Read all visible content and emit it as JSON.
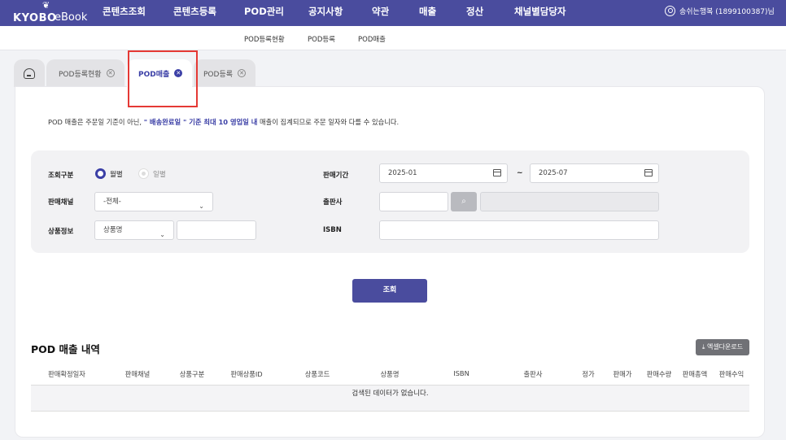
{
  "header": {
    "logo": "KYOBO eBook",
    "logo_kyobo": "KYOBO",
    "logo_ebook": "eBook",
    "logo_bird": "❦",
    "menu": [
      "콘텐츠조회",
      "콘텐츠등록",
      "POD관리",
      "공지사항",
      "약관",
      "매출",
      "정산",
      "채널별담당자"
    ],
    "user": "송쉬는행복 (1899100387)님"
  },
  "submenu": [
    "POD등록현황",
    "POD등록",
    "POD매출"
  ],
  "tabs": {
    "home_icon": "home-icon",
    "items": [
      {
        "label": "POD등록현황",
        "active": false
      },
      {
        "label": "POD매출",
        "active": true
      },
      {
        "label": "POD등록",
        "active": false
      }
    ],
    "close_glyph": "✕"
  },
  "notice": {
    "prefix": "POD 매출은 주문일 기준이 아닌, ",
    "highlight": "\" 배송완료일 \" 기준 최대 10 영업일 내",
    "suffix": " 매출이 집계되므로 주문 일자와 다를 수 있습니다."
  },
  "filter": {
    "type_label": "조회구분",
    "type_options": [
      "월별",
      "일별"
    ],
    "type_selected": "월별",
    "period_label": "판매기간",
    "period_from": "2025-01",
    "period_sep": "~",
    "period_to": "2025-07",
    "channel_label": "판매채널",
    "channel_value": "-전체-",
    "publisher_label": "출판사",
    "publisher_value": "",
    "publisher_name": "",
    "product_label": "상품정보",
    "product_type_value": "상품명",
    "product_value": "",
    "isbn_label": "ISBN",
    "isbn_value": "",
    "search_glyph": "⌕",
    "chevron": "⌄"
  },
  "search_button": "조회",
  "results": {
    "title": "POD 매출 내역",
    "excel_button": "⤓ 엑셀다운로드",
    "columns": [
      "판매확정일자",
      "판매채널",
      "상품구분",
      "판매상품ID",
      "상품코드",
      "상품명",
      "ISBN",
      "출판사",
      "정가",
      "판매가",
      "판매수량",
      "판매총액",
      "판매수익"
    ],
    "empty_message": "검색된 데이터가 없습니다."
  },
  "colors": {
    "brand": "#4a4c9e",
    "accent": "#3b3fa6",
    "highlight_box": "#e53935"
  }
}
